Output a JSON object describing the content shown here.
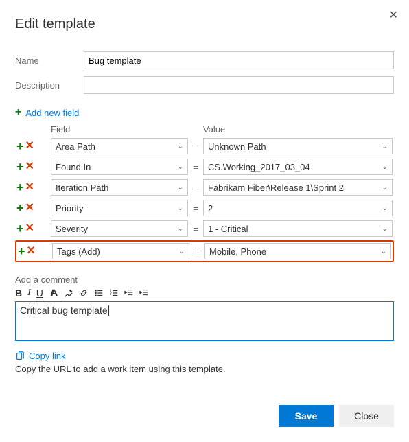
{
  "dialog": {
    "title": "Edit template",
    "close_symbol": "✕"
  },
  "form": {
    "name_label": "Name",
    "name_value": "Bug template",
    "desc_label": "Description",
    "desc_value": ""
  },
  "add_field": {
    "plus": "+",
    "label": "Add new field"
  },
  "grid": {
    "header_field": "Field",
    "header_value": "Value",
    "eq": "=",
    "rows": [
      {
        "field": "Area Path",
        "value": "Unknown Path",
        "highlight": false
      },
      {
        "field": "Found In",
        "value": "CS.Working_2017_03_04",
        "highlight": false
      },
      {
        "field": "Iteration Path",
        "value": "Fabrikam Fiber\\Release 1\\Sprint 2",
        "highlight": false
      },
      {
        "field": "Priority",
        "value": "2",
        "highlight": false
      },
      {
        "field": "Severity",
        "value": "1 - Critical",
        "highlight": false
      },
      {
        "field": "Tags (Add)",
        "value": "Mobile, Phone",
        "highlight": true
      }
    ]
  },
  "comment": {
    "label": "Add a comment",
    "text": "Critical bug template",
    "toolbar": {
      "bold": "B",
      "italic": "I",
      "underline": "U"
    }
  },
  "copy": {
    "link_label": "Copy link",
    "desc": "Copy the URL to add a work item using this template."
  },
  "footer": {
    "save": "Save",
    "close": "Close"
  }
}
